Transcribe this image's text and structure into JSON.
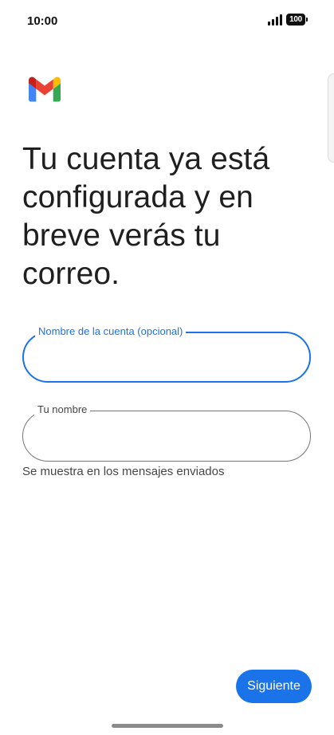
{
  "status_bar": {
    "time": "10:00",
    "battery_level": "100",
    "signal_icon": "signal-bars-icon"
  },
  "logo": {
    "icon": "gmail-logo-icon",
    "colors": {
      "blue": "#4285f4",
      "red": "#ea4335",
      "yellow": "#fbbc04",
      "green": "#34a853",
      "dark_red": "#c5221f"
    }
  },
  "headline": "Tu cuenta ya está configurada y en breve verás tu correo.",
  "form": {
    "account_name": {
      "label": "Nombre de la cuenta (opcional)",
      "value": "",
      "focused": true
    },
    "your_name": {
      "label": "Tu nombre",
      "value": "",
      "helper": "Se muestra en los mensajes enviados"
    }
  },
  "actions": {
    "next_label": "Siguiente"
  },
  "theme": {
    "accent": "#1a73e8",
    "text": "#1f1f1f",
    "outline": "#747775"
  }
}
